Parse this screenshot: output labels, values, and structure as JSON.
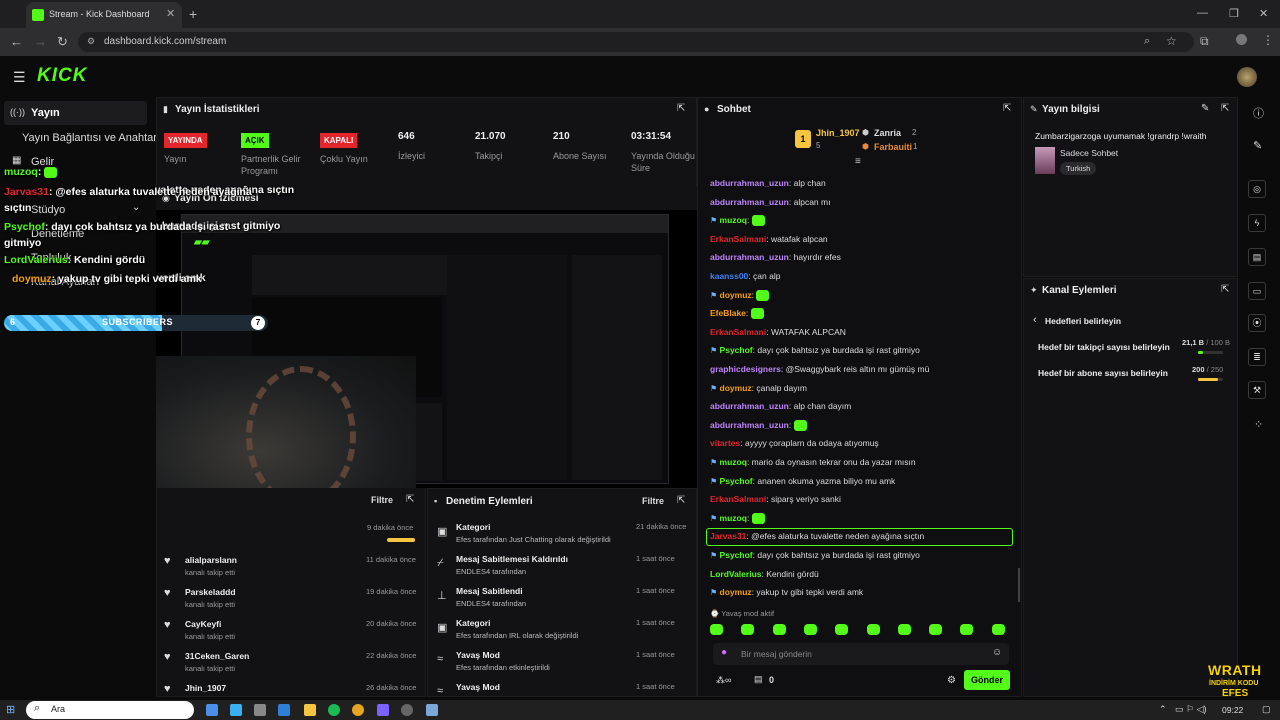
{
  "browser": {
    "tab_title": "Stream - Kick Dashboard",
    "url": "dashboard.kick.com/stream"
  },
  "brand": {
    "logo": "KICK",
    "accent": "#53fc18"
  },
  "sidebar": {
    "items": [
      {
        "label": "Yayın"
      },
      {
        "label": "Yayın Bağlantısı ve Anahtarı"
      },
      {
        "label": "Gelir"
      },
      {
        "label": "Stüdyo"
      },
      {
        "label": "Denetleme"
      },
      {
        "label": "Topluluk"
      },
      {
        "label": "Kanal Ayarları"
      }
    ]
  },
  "stats_panel": {
    "title": "Yayın İstatistikleri",
    "items": [
      {
        "badge": "YAYINDA",
        "label": "Yayın"
      },
      {
        "badge": "AÇIK",
        "label": "Partnerlik Gelir Programı"
      },
      {
        "badge": "KAPALI",
        "label": "Çoklu Yayın"
      },
      {
        "value": "646",
        "label": "İzleyici"
      },
      {
        "value": "21.070",
        "label": "Takipçi"
      },
      {
        "value": "210",
        "label": "Abone Sayısı"
      },
      {
        "value": "03:31:54",
        "label": "Yayında Olduğu Süre"
      }
    ]
  },
  "preview_panel": {
    "title": "Yayın Ön İzlemesi"
  },
  "overlay": {
    "lines": [
      {
        "user": "muzoq",
        "text": ":"
      },
      {
        "user": "Jarvas31",
        "text": ": @efes alaturka tuvalette neden ayağına sıçtın"
      },
      {
        "user": "Psychof",
        "text": ": dayı çok bahtsız ya burdada işi rast gitmiyo"
      },
      {
        "user": "LordValerius",
        "text": ": Kendini gördü"
      },
      {
        "user": "doymuz",
        "text": ": yakup tv gibi tepki verdi amk"
      }
    ],
    "sub_goal": {
      "left": "6",
      "label": "SUBSCRIBERS",
      "right": "7",
      "progress": 0.6
    }
  },
  "activity_left": {
    "filter_label": "Filtre",
    "items": [
      {
        "name": "",
        "action": "",
        "time": "9 dakika önce"
      },
      {
        "name": "alialparslann",
        "action": "kanalı takip etti",
        "time": "11 dakika önce"
      },
      {
        "name": "Parskeladdd",
        "action": "kanalı takip etti",
        "time": "19 dakika önce"
      },
      {
        "name": "CayKeyfi",
        "action": "kanalı takip etti",
        "time": "20 dakika önce"
      },
      {
        "name": "31Ceken_Garen",
        "action": "kanalı takip etti",
        "time": "22 dakika önce"
      },
      {
        "name": "Jhin_1907",
        "action": "",
        "time": "26 dakika önce"
      }
    ]
  },
  "moderation": {
    "title": "Denetim Eylemleri",
    "filter_label": "Filtre",
    "items": [
      {
        "title": "Kategori",
        "line": "Efes tarafından Just Chatting olarak değiştirildi",
        "time": "21 dakika önce"
      },
      {
        "title": "Mesaj Sabitlemesi Kaldırıldı",
        "line": "ENDLES4 tarafından",
        "time": "1 saat önce"
      },
      {
        "title": "Mesaj Sabitlendi",
        "line": "ENDLES4 tarafından",
        "time": "1 saat önce"
      },
      {
        "title": "Kategori",
        "line": "Efes tarafından IRL olarak değiştirildi",
        "time": "1 saat önce"
      },
      {
        "title": "Yavaş Mod",
        "line": "Efes tarafından etkinleştirildi",
        "time": "1 saat önce"
      },
      {
        "title": "Yavaş Mod",
        "line": "",
        "time": "1 saat önce"
      }
    ]
  },
  "chat": {
    "title": "Sohbet",
    "top": [
      {
        "name": "Jhin_1907",
        "count": "5"
      },
      {
        "name": "Zanria",
        "count": "2"
      },
      {
        "name": "Farbauiti",
        "count": "1"
      }
    ],
    "messages": [
      {
        "user": "abdurrahman_uzun",
        "color": "#c084fc",
        "text": ": alp chan"
      },
      {
        "user": "abdurrahman_uzun",
        "color": "#c084fc",
        "text": ": alpcan mı"
      },
      {
        "user": "muzoq",
        "color": "#53fc18",
        "text": ":"
      },
      {
        "user": "ErkanSalmani",
        "color": "#e5252c",
        "text": ": watafak alpcan"
      },
      {
        "user": "abdurrahman_uzun",
        "color": "#c084fc",
        "text": ": hayırdır efes"
      },
      {
        "user": "kaanss00",
        "color": "#3b82f6",
        "text": ": çan alp"
      },
      {
        "user": "doymuz",
        "color": "#f59e0b",
        "text": ":"
      },
      {
        "user": "EfeBlake",
        "color": "#f59e0b",
        "text": ":"
      },
      {
        "user": "ErkanSalmani",
        "color": "#e5252c",
        "text": ": WATAFAK ALPCAN"
      },
      {
        "user": "Psychof",
        "color": "#53fc18",
        "text": ": dayı çok bahtsız ya burdada işi rast gitmiyo"
      },
      {
        "user": "graphicdesigners",
        "color": "#c084fc",
        "text": ": @Swaggybark reis altın mı gümüş mü"
      },
      {
        "user": "doymuz",
        "color": "#f59e0b",
        "text": ": çanalp dayım"
      },
      {
        "user": "abdurrahman_uzun",
        "color": "#c084fc",
        "text": ": alp chan dayım"
      },
      {
        "user": "abdurrahman_uzun",
        "color": "#c084fc",
        "text": ":"
      },
      {
        "user": "vitartes",
        "color": "#e5252c",
        "text": ": ayyyy çoraplarn da odaya atıyomuş"
      },
      {
        "user": "muzoq",
        "color": "#53fc18",
        "text": ": mario da oynasın tekrar onu da yazar mısın"
      },
      {
        "user": "Psychof",
        "color": "#53fc18",
        "text": ": ananen okuma yazma biliyo mu amk"
      },
      {
        "user": "ErkanSalmani",
        "color": "#e5252c",
        "text": ": siparş veriyo sanki"
      },
      {
        "user": "muzoq",
        "color": "#53fc18",
        "text": ":"
      },
      {
        "user": "Jarvas31",
        "color": "#e5252c",
        "text": ": @efes alaturka tuvalette neden ayağına sıçtın"
      },
      {
        "user": "Psychof",
        "color": "#53fc18",
        "text": ": dayı çok bahtsız ya burdada işi rast gitmiyo"
      },
      {
        "user": "LordValerius",
        "color": "#53fc18",
        "text": ": Kendini gördü"
      },
      {
        "user": "doymuz",
        "color": "#f59e0b",
        "text": ": yakup tv gibi tepki verdi amk"
      }
    ],
    "slow_mode": "Yavaş mod aktif",
    "input_placeholder": "Bir mesaj gönderin",
    "points": "0",
    "send_label": "Gönder"
  },
  "stream_info": {
    "title": "Yayın bilgisi",
    "stream_title": "Zumbarzigarzoga uyumamak !grandrp !wraith",
    "category": "Sadece Sohbet",
    "language": "Turkish"
  },
  "channel_actions": {
    "title": "Kanal Eylemleri",
    "back_label": "Hedefleri belirleyin",
    "goals": [
      {
        "label": "Hedef bir takipçi sayısı belirleyin",
        "current": "21,1 B",
        "target": "/ 100 B",
        "progress": 0.21
      },
      {
        "label": "Hedef bir abone sayısı belirleyin",
        "current": "200",
        "target": "/ 250",
        "progress": 0.8
      }
    ]
  },
  "taskbar": {
    "search": "Ara",
    "time": "09:22"
  },
  "watermark": {
    "line1": "WRATH",
    "line2": "İNDİRİM KODU",
    "line3": "EFES"
  }
}
